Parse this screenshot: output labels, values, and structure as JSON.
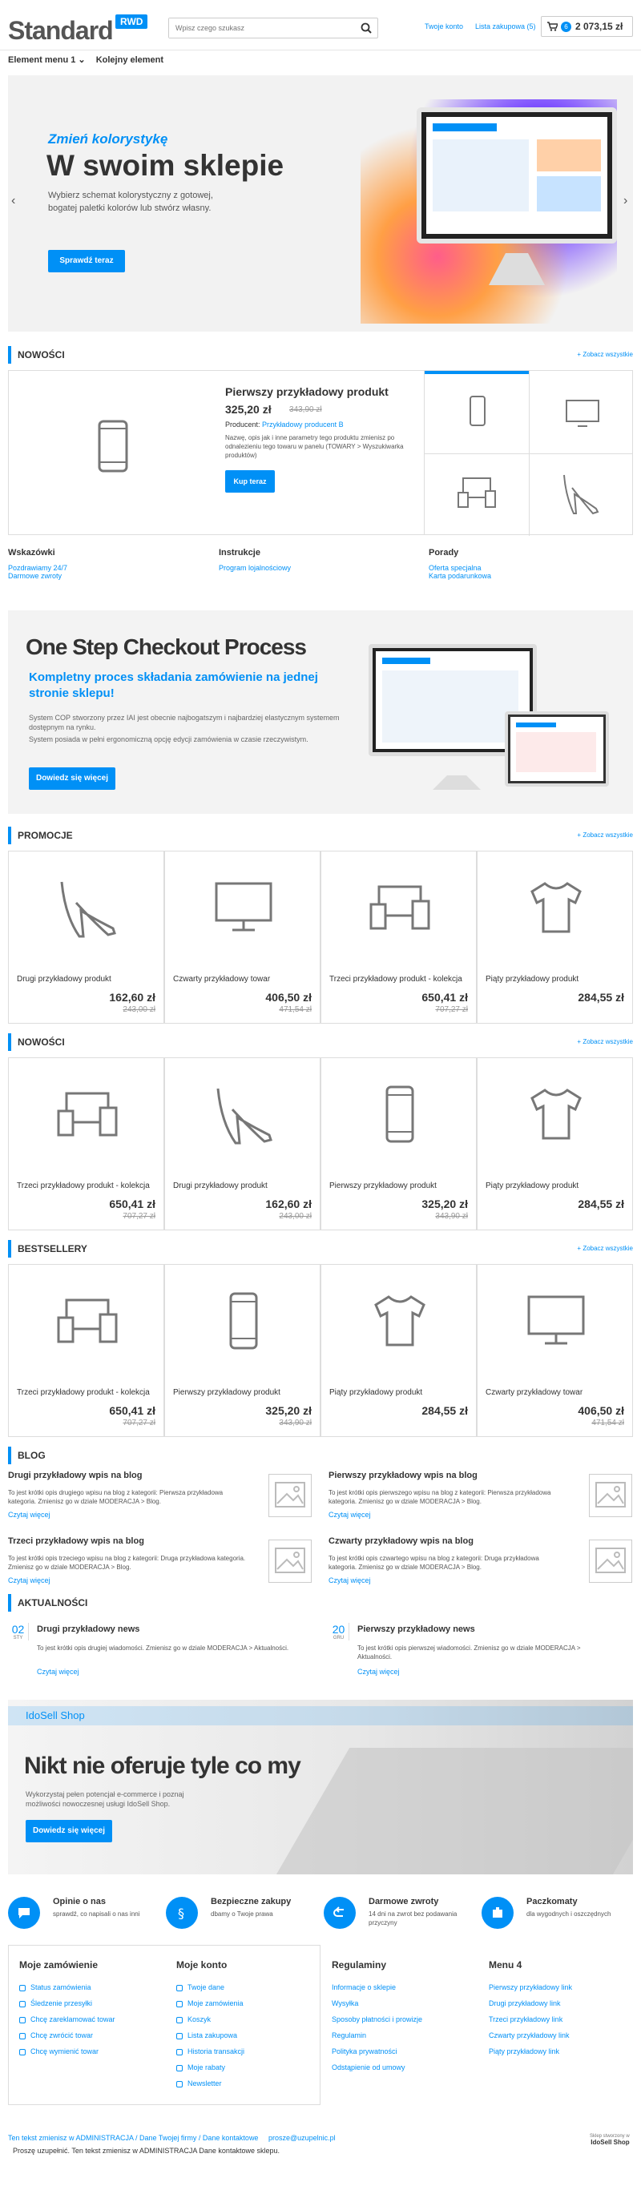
{
  "header": {
    "logo": "Standard",
    "badge": "RWD",
    "search_placeholder": "Wpisz czego szukasz",
    "account": "Twoje konto",
    "shoplist": "Lista zakupowa (5)",
    "cart_count": "6",
    "cart_total": "2 073,15 zł"
  },
  "nav": {
    "item1": "Element menu 1",
    "item2": "Kolejny element"
  },
  "hero": {
    "kicker": "Zmień kolorystykę",
    "title": "W swoim sklepie",
    "text": "Wybierz schemat kolorystyczny z gotowej, bogatej paletki kolorów lub stwórz własny.",
    "button": "Sprawdź teraz"
  },
  "nowosci1": {
    "title": "NOWOŚCI",
    "seeall": "+ Zobacz wszystkie",
    "feat_name": "Pierwszy przykładowy produkt",
    "feat_price": "325,20 zł",
    "feat_old": "343,90 zł",
    "producer_label": "Producent:",
    "producer": "Przykładowy producent B",
    "desc": "Nazwę, opis jak i inne parametry tego produktu zmienisz po odnalezieniu tego towaru w panelu (TOWARY > Wyszukiwarka produktów)",
    "buy": "Kup teraz"
  },
  "links": [
    {
      "title": "Wskazówki",
      "items": [
        "Pozdrawiamy 24/7",
        "Darmowe zwroty"
      ]
    },
    {
      "title": "Instrukcje",
      "items": [
        "Program lojalnościowy"
      ]
    },
    {
      "title": "Porady",
      "items": [
        "Oferta specjalna",
        "Karta podarunkowa"
      ]
    }
  ],
  "checkout": {
    "title": "One Step Checkout Process",
    "sub": "Kompletny proces składania zamówienie na jednej stronie sklepu!",
    "text1": "System COP stworzony przez IAI jest obecnie najbogatszym i najbardziej elastycznym systemem dostępnym na rynku.",
    "text2": "System posiada w pełni ergonomiczną opcję edycji zamówienia w czasie rzeczywistym.",
    "button": "Dowiedz się więcej"
  },
  "promocje": {
    "title": "PROMOCJE",
    "seeall": "+ Zobacz wszystkie",
    "items": [
      {
        "name": "Drugi przykładowy produkt",
        "price": "162,60 zł",
        "old": "243,00 zł",
        "icon": "heel-icon"
      },
      {
        "name": "Czwarty przykładowy towar",
        "price": "406,50 zł",
        "old": "471,54 zł",
        "icon": "monitor-icon"
      },
      {
        "name": "Trzeci przykładowy produkt - kolekcja",
        "price": "650,41 zł",
        "old": "707,27 zł",
        "icon": "devices-icon"
      },
      {
        "name": "Piąty przykładowy produkt",
        "price": "284,55 zł",
        "old": "",
        "icon": "shirt-icon"
      }
    ]
  },
  "nowosci2": {
    "title": "NOWOŚCI",
    "seeall": "+ Zobacz wszystkie",
    "items": [
      {
        "name": "Trzeci przykładowy produkt - kolekcja",
        "price": "650,41 zł",
        "old": "707,27 zł",
        "icon": "devices-icon"
      },
      {
        "name": "Drugi przykładowy produkt",
        "price": "162,60 zł",
        "old": "243,00 zł",
        "icon": "heel-icon"
      },
      {
        "name": "Pierwszy przykładowy produkt",
        "price": "325,20 zł",
        "old": "343,90 zł",
        "icon": "phone-icon"
      },
      {
        "name": "Piąty przykładowy produkt",
        "price": "284,55 zł",
        "old": "",
        "icon": "shirt-icon"
      }
    ]
  },
  "bestsellery": {
    "title": "BESTSELLERY",
    "seeall": "+ Zobacz wszystkie",
    "items": [
      {
        "name": "Trzeci przykładowy produkt - kolekcja",
        "price": "650,41 zł",
        "old": "707,27 zł",
        "icon": "devices-icon"
      },
      {
        "name": "Pierwszy przykładowy produkt",
        "price": "325,20 zł",
        "old": "343,90 zł",
        "icon": "phone-icon"
      },
      {
        "name": "Piąty przykładowy produkt",
        "price": "284,55 zł",
        "old": "",
        "icon": "shirt-icon"
      },
      {
        "name": "Czwarty przykładowy towar",
        "price": "406,50 zł",
        "old": "471,54 zł",
        "icon": "monitor-icon"
      }
    ]
  },
  "blog": {
    "title": "BLOG",
    "more": "Czytaj więcej",
    "posts": [
      {
        "title": "Drugi przykładowy wpis na blog",
        "text": "To jest krótki opis drugiego wpisu na blog z kategorii: Pierwsza przykładowa kategoria. Zmienisz go w dziale MODERACJA > Blog."
      },
      {
        "title": "Pierwszy przykładowy wpis na blog",
        "text": "To jest krótki opis pierwszego wpisu na blog z kategorii: Pierwsza przykładowa kategoria. Zmienisz go w dziale MODERACJA > Blog."
      },
      {
        "title": "Trzeci przykładowy wpis na blog",
        "text": "To jest krótki opis trzeciego wpisu na blog z kategorii: Druga przykładowa kategoria. Zmienisz go w dziale MODERACJA > Blog."
      },
      {
        "title": "Czwarty przykładowy wpis na blog",
        "text": "To jest krótki opis czwartego wpisu na blog z kategorii: Druga przykładowa kategoria. Zmienisz go w dziale MODERACJA > Blog."
      }
    ]
  },
  "news": {
    "title": "AKTUALNOŚCI",
    "more": "Czytaj więcej",
    "items": [
      {
        "day": "02",
        "mon": "STY",
        "title": "Drugi przykładowy news",
        "text": "To jest krótki opis drugiej wiadomości. Zmienisz go w dziale MODERACJA > Aktualności."
      },
      {
        "day": "20",
        "mon": "GRU",
        "title": "Pierwszy przykładowy news",
        "text": "To jest krótki opis pierwszej wiadomości. Zmienisz go w dziale MODERACJA > Aktualności."
      }
    ]
  },
  "idosell": {
    "tag": "IdoSell Shop",
    "title": "Nikt nie oferuje tyle co my",
    "text": "Wykorzystaj pełen potencjał e-commerce i poznaj możliwości nowoczesnej usługi IdoSell Shop.",
    "button": "Dowiedz się więcej"
  },
  "features": [
    {
      "title": "Opinie o nas",
      "text": "sprawdź, co napisali o nas inni",
      "icon": "chat-icon"
    },
    {
      "title": "Bezpieczne zakupy",
      "text": "dbamy o Twoje prawa",
      "icon": "paragraph-icon"
    },
    {
      "title": "Darmowe zwroty",
      "text": "14 dni na zwrot bez podawania przyczyny",
      "icon": "return-icon"
    },
    {
      "title": "Paczkomaty",
      "text": "dla wygodnych i oszczędnych",
      "icon": "box-icon"
    }
  ],
  "footer": {
    "col1": {
      "title": "Moje zamówienie",
      "items": [
        "Status zamówienia",
        "Śledzenie przesyłki",
        "Chcę zareklamować towar",
        "Chcę zwrócić towar",
        "Chcę wymienić towar"
      ]
    },
    "col2": {
      "title": "Moje konto",
      "items": [
        "Twoje dane",
        "Moje zamówienia",
        "Koszyk",
        "Lista zakupowa",
        "Historia transakcji",
        "Moje rabaty",
        "Newsletter"
      ]
    },
    "col3": {
      "title": "Regulaminy",
      "items": [
        "Informacje o sklepie",
        "Wysyłka",
        "Sposoby płatności i prowizje",
        "Regulamin",
        "Polityka prywatności",
        "Odstąpienie od umowy"
      ]
    },
    "col4": {
      "title": "Menu 4",
      "items": [
        "Pierwszy przykładowy link",
        "Drugi przykładowy link",
        "Trzeci przykładowy link",
        "Czwarty przykładowy link",
        "Piąty przykładowy link"
      ]
    },
    "bottom_link": "Ten tekst zmienisz w ADMINISTRACJA / Dane Twojej firmy / Dane kontaktowe",
    "email": "prosze@uzupelnic.pl",
    "note": "Proszę uzupełnić. Ten tekst zmienisz w ADMINISTRACJA Dane kontaktowe sklepu.",
    "credit": "Sklep stworzony w",
    "brand": "IdoSell Shop"
  }
}
